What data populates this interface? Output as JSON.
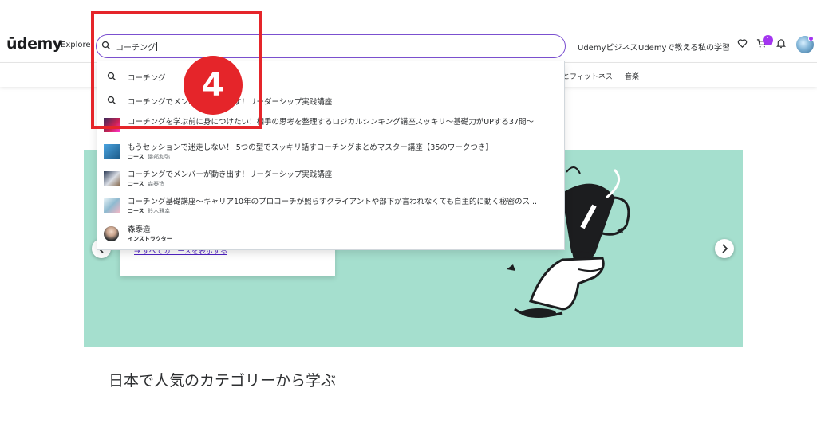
{
  "header": {
    "logo": "ūdemy",
    "explore": "Explore",
    "search_value": "コーチング",
    "nav_business": "Udemyビジネス",
    "nav_teach": "Udemyで教える",
    "nav_learning": "私の学習",
    "cart_count": "1"
  },
  "categories": {
    "health": "とフィットネス",
    "music": "音楽"
  },
  "dropdown": {
    "suggestions": [
      "コーチング",
      "コーチングでメンバーが動き出す！リーダーシップ実践講座"
    ],
    "courses": [
      {
        "title": "コーチングを学ぶ前に身につけたい！相手の思考を整理するロジカルシンキング講座スッキリ〜基礎力がUPする37問〜",
        "type": "",
        "author": ""
      },
      {
        "title": "もうセッションで迷走しない！ 5つの型でスッキリ話すコーチングまとめマスター講座【35のワークつき】",
        "type": "コース",
        "author": "磯部和弥"
      },
      {
        "title": "コーチングでメンバーが動き出す！リーダーシップ実践講座",
        "type": "コース",
        "author": "森泰造"
      },
      {
        "title": "コーチング基礎講座〜キャリア10年のプロコーチが照らすクライアントや部下が言われなくても自主的に動く秘密のス...",
        "type": "コース",
        "author": "鈴木雅幸"
      }
    ],
    "instructor": {
      "name": "森泰造",
      "type": "インストラクター"
    }
  },
  "banner": {
    "link_text": "→ すべてのコースを表示する"
  },
  "section_title": "日本で人気のカテゴリーから学ぶ",
  "annotation": {
    "number": "4"
  },
  "colors": {
    "accent": "#a435f0",
    "search_border": "#7b50d0",
    "banner_bg": "#a5dfce",
    "annotation_red": "#e5252a"
  }
}
